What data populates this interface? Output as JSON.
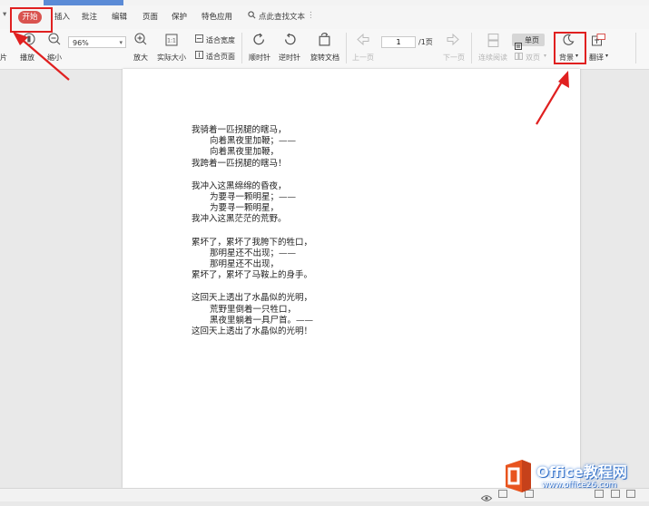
{
  "menu": {
    "start": "开始",
    "insert": "插入",
    "annotate": "批注",
    "edit": "编辑",
    "page": "页面",
    "protect": "保护",
    "features": "特色应用",
    "search": "点此查找文本"
  },
  "toolbar": {
    "play": "播放",
    "zoom_out": "缩小",
    "zoom_value": "96%",
    "zoom_in": "放大",
    "actual_size": "实际大小",
    "fit_width": "适合宽度",
    "fit_page": "适合页面",
    "rotate_cw": "顺时针",
    "rotate_ccw": "逆时针",
    "rotate_doc": "旋转文档",
    "prev_page": "上一页",
    "page_current": "1",
    "page_total": "/1页",
    "next_page": "下一页",
    "continuous": "连续阅读",
    "single": "单页",
    "double": "双页",
    "background": "背景",
    "translate": "翻译",
    "cutoff_left": "片"
  },
  "document": {
    "stanzas": [
      [
        "我骑着一匹拐腿的瞎马，",
        "向着黑夜里加鞭；——",
        "向着黑夜里加鞭，",
        "我跨着一匹拐腿的瞎马！"
      ],
      [
        "我冲入这黑绵绵的昏夜，",
        "为要寻一颗明星；——",
        "为要寻一颗明星，",
        "我冲入这黑茫茫的荒野。"
      ],
      [
        "累坏了，累坏了我胯下的牲口，",
        "那明星还不出现；——",
        "那明星还不出现，",
        "累坏了，累坏了马鞍上的身手。"
      ],
      [
        "这回天上透出了水晶似的光明，",
        "荒野里倒着一只牲口，",
        "黑夜里躺着一具尸首。——",
        "这回天上透出了水晶似的光明！"
      ]
    ]
  },
  "watermark": {
    "title": "Office教程网",
    "url": "www.office26.com"
  },
  "colors": {
    "accent_red": "#d9534f",
    "highlight_red": "#e02020",
    "watermark_blue": "#3b7bd5"
  }
}
